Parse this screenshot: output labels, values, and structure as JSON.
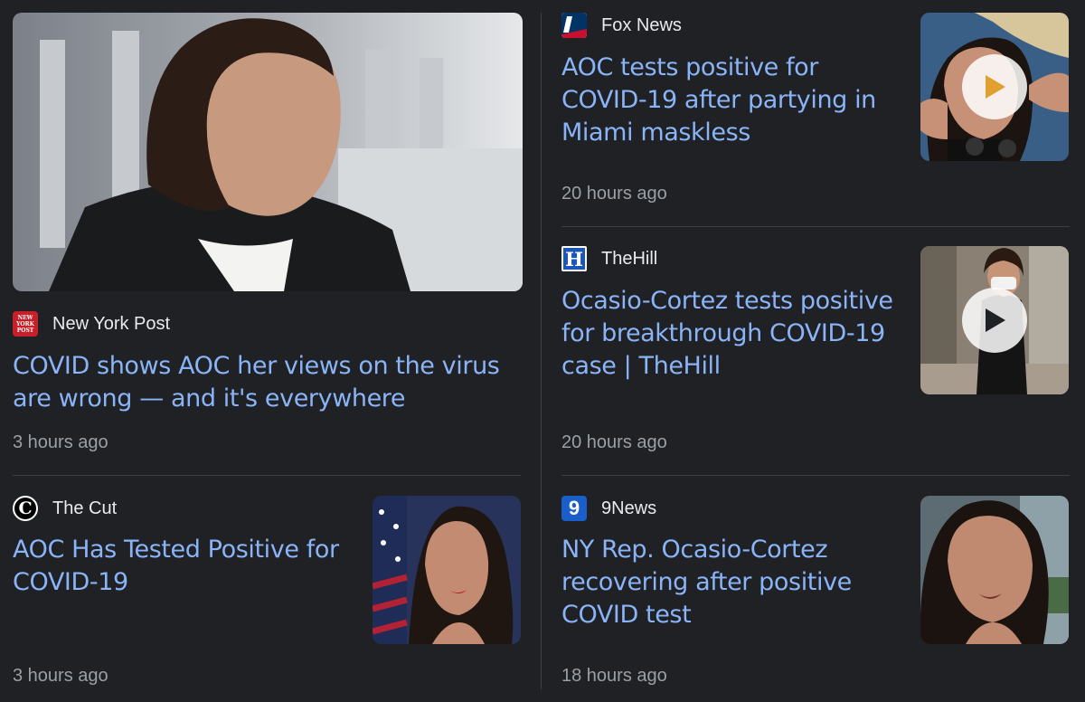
{
  "featured": {
    "source": "New York Post",
    "headline": "COVID shows AOC her views on the virus are wrong — and it's everywhere",
    "time": "3 hours ago",
    "logo_text": "NEW YORK POST"
  },
  "cut": {
    "source": "The Cut",
    "headline": "AOC Has Tested Positive for COVID-19",
    "time": "3 hours ago",
    "logo_text": "C"
  },
  "fox": {
    "source": "Fox News",
    "headline": "AOC tests positive for COVID-19 after partying in Miami maskless",
    "time": "20 hours ago"
  },
  "thehill": {
    "source": "TheHill",
    "headline": "Ocasio-Cortez tests positive for breakthrough COVID-19 case | TheHill",
    "time": "20 hours ago",
    "logo_text": "H"
  },
  "ninenews": {
    "source": "9News",
    "headline": "NY Rep. Ocasio-Cortez recovering after positive COVID test",
    "time": "18 hours ago",
    "logo_text": "9"
  },
  "colors": {
    "background": "#202124",
    "headline": "#8ab4f8",
    "source": "#e8eaed",
    "time": "#9aa0a6",
    "divider": "#3c4043"
  }
}
